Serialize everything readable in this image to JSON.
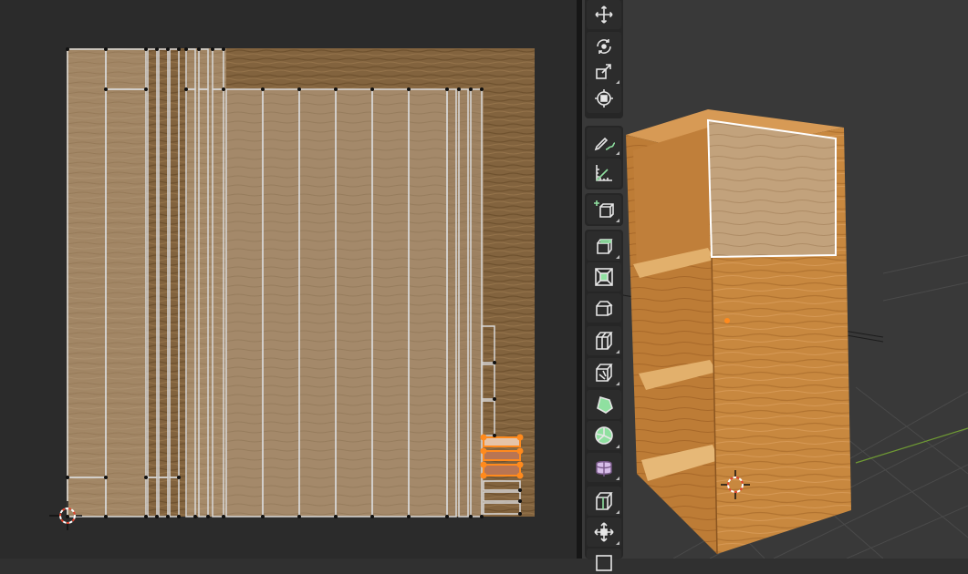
{
  "uv_editor": {
    "texture": "wood-grain",
    "colors": {
      "background": "#2b2b2b",
      "texture_light": "#a58a69",
      "texture_dark": "#7e5f3a",
      "edge": "#d8d8d8",
      "vertex": "#101010",
      "selected": "#ff8a1d"
    },
    "cursor_icon": "2d-cursor-icon"
  },
  "toolbar": {
    "tools": [
      {
        "name": "move-tool",
        "icon": "move-icon",
        "has_submenu": false
      },
      {
        "name": "rotate-tool",
        "icon": "rotate-icon",
        "has_submenu": false
      },
      {
        "name": "scale-tool",
        "icon": "scale-icon",
        "has_submenu": true
      },
      {
        "name": "transform-tool",
        "icon": "transform-icon",
        "has_submenu": false
      },
      {
        "name": "annotate-tool",
        "icon": "annotate-icon",
        "has_submenu": true
      },
      {
        "name": "measure-tool",
        "icon": "measure-icon",
        "has_submenu": false
      },
      {
        "name": "add-cube-tool",
        "icon": "add-cube-icon",
        "has_submenu": true
      },
      {
        "name": "extrude-region-tool",
        "icon": "extrude-region-icon",
        "has_submenu": true
      },
      {
        "name": "inset-faces-tool",
        "icon": "inset-faces-icon",
        "has_submenu": false
      },
      {
        "name": "bevel-tool",
        "icon": "bevel-icon",
        "has_submenu": false
      },
      {
        "name": "loop-cut-tool",
        "icon": "loop-cut-icon",
        "has_submenu": true
      },
      {
        "name": "knife-tool",
        "icon": "knife-icon",
        "has_submenu": true
      },
      {
        "name": "poly-build-tool",
        "icon": "poly-build-icon",
        "has_submenu": false
      },
      {
        "name": "spin-tool",
        "icon": "spin-icon",
        "has_submenu": true
      },
      {
        "name": "smooth-tool",
        "icon": "smooth-icon",
        "has_submenu": true
      },
      {
        "name": "edge-slide-tool",
        "icon": "edge-slide-icon",
        "has_submenu": true
      },
      {
        "name": "shrink-fatten-tool",
        "icon": "shrink-fatten-icon",
        "has_submenu": true
      },
      {
        "name": "rip-region-tool",
        "icon": "rip-region-icon",
        "has_submenu": false
      }
    ],
    "colors": {
      "panel": "#262626",
      "button": "#2c2c2c",
      "icon": "#e6e6e6",
      "accent_green": "#8fe0a0",
      "accent_purple": "#d7bde8"
    }
  },
  "viewport": {
    "object": "wooden-shelf-cabinet",
    "colors": {
      "background": "#393939",
      "wood_front": "#c8883f",
      "wood_side": "#b97a35",
      "wood_inner": "#d79a55",
      "selected_face_outline": "#ffffff",
      "grid_line": "#4a4a4a",
      "x_axis": "#a33c3c",
      "y_axis": "#6f9a34"
    },
    "cursor_icon": "3d-cursor-icon"
  }
}
